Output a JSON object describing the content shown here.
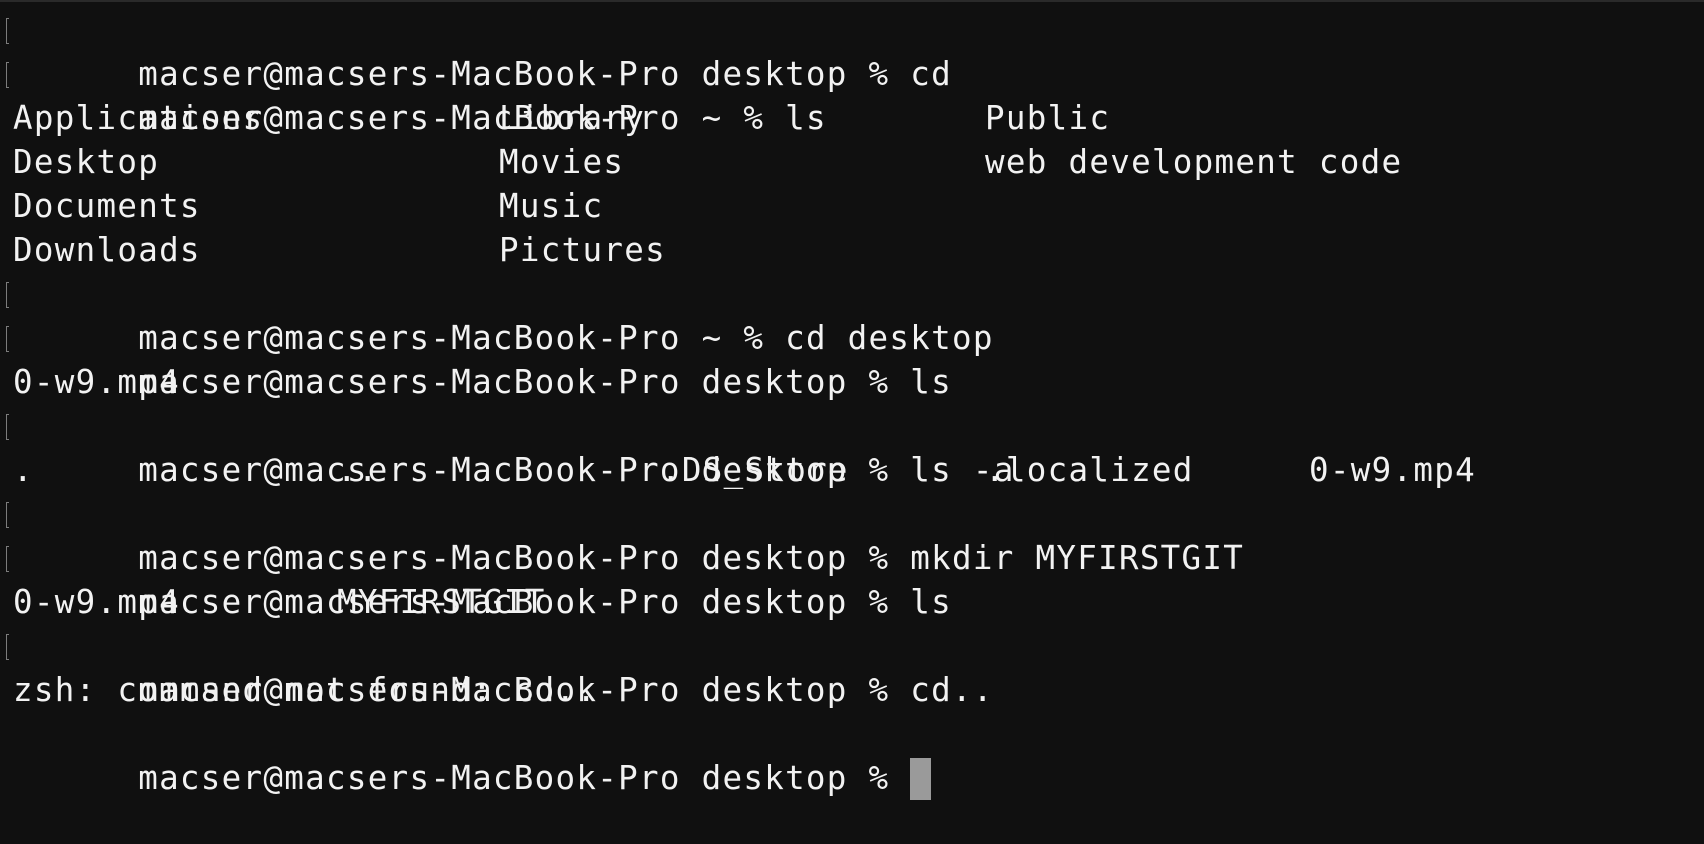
{
  "session": {
    "lines": [
      {
        "kind": "prompt",
        "prompt": "macser@macsers-MacBook-Pro desktop % ",
        "command": "cd"
      },
      {
        "kind": "prompt",
        "prompt": "macser@macsers-MacBook-Pro ~ % ",
        "command": "ls"
      },
      {
        "kind": "output",
        "cells": [
          "Applications",
          "Library",
          "Public"
        ]
      },
      {
        "kind": "output",
        "cells": [
          "Desktop",
          "Movies",
          "web development code"
        ]
      },
      {
        "kind": "output",
        "cells": [
          "Documents",
          "Music"
        ]
      },
      {
        "kind": "output",
        "cells": [
          "Downloads",
          "Pictures"
        ]
      },
      {
        "kind": "prompt",
        "prompt": "macser@macsers-MacBook-Pro ~ % ",
        "command": "cd desktop"
      },
      {
        "kind": "prompt",
        "prompt": "macser@macsers-MacBook-Pro desktop % ",
        "command": "ls"
      },
      {
        "kind": "output",
        "cells": [
          "0-w9.mp4"
        ]
      },
      {
        "kind": "prompt",
        "prompt": "macser@macsers-MacBook-Pro desktop % ",
        "command": "ls -a"
      },
      {
        "kind": "output",
        "cells": [
          ".",
          "..",
          ".DS_Store",
          ".localized",
          "0-w9.mp4"
        ]
      },
      {
        "kind": "prompt",
        "prompt": "macser@macsers-MacBook-Pro desktop % ",
        "command": "mkdir MYFIRSTGIT"
      },
      {
        "kind": "prompt",
        "prompt": "macser@macsers-MacBook-Pro desktop % ",
        "command": "ls"
      },
      {
        "kind": "output",
        "cells": [
          "0-w9.mp4",
          "MYFIRSTGIT"
        ]
      },
      {
        "kind": "prompt",
        "prompt": "macser@macsers-MacBook-Pro desktop % ",
        "command": "cd.."
      },
      {
        "kind": "output",
        "cells": [
          "zsh: command not found: cd.."
        ]
      },
      {
        "kind": "active",
        "prompt": "macser@macsers-MacBook-Pro desktop % ",
        "command": ""
      }
    ]
  },
  "colors": {
    "background": "#101010",
    "text": "#f2f2f2",
    "cursor": "#9a9a9a",
    "mark": "#7c7c7c"
  }
}
